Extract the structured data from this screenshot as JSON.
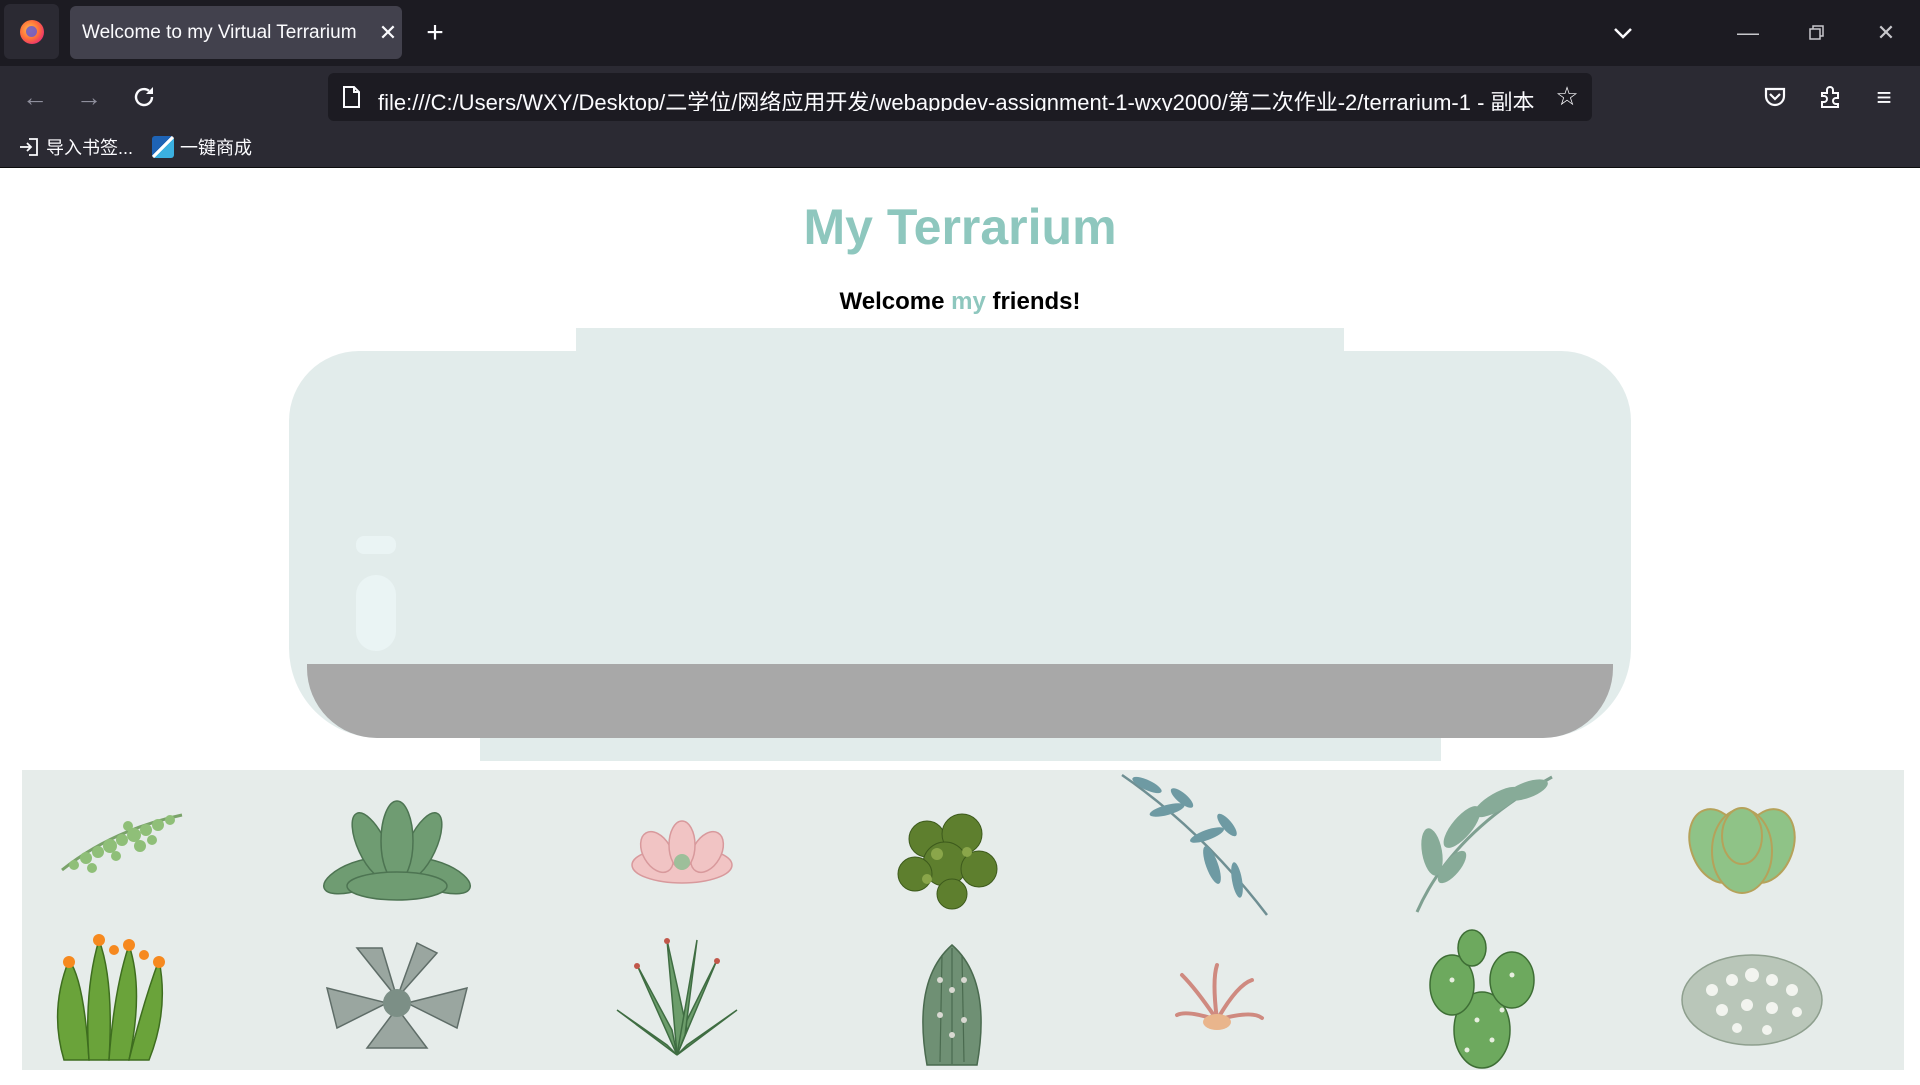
{
  "browser": {
    "tab_title": "Welcome to my Virtual Terrarium",
    "url": "file:///C:/Users/WXY/Desktop/二学位/网络应用开发/webappdev-assignment-1-wxy2000/第二次作业-2/terrarium-1 - 副本",
    "bookmarks": [
      {
        "label": "导入书签..."
      },
      {
        "label": "一键商成"
      }
    ],
    "icons": {
      "tab_close": "close-icon",
      "new_tab": "plus-icon",
      "list_tabs": "chevron-down-icon",
      "back": "arrow-left-icon",
      "forward": "arrow-right-icon",
      "reload": "reload-icon",
      "page": "page-icon",
      "bookmark_star": "star-icon",
      "pocket": "pocket-icon",
      "extensions": "puzzle-icon",
      "menu": "hamburger-icon"
    }
  },
  "page": {
    "title": "My Terrarium",
    "welcome_before": "Welcome ",
    "welcome_accent": "my",
    "welcome_after": " friends!",
    "accent_color": "#8ec7be",
    "jar_color": "#e2eceb",
    "dirt_color": "#a8a8a8"
  },
  "plants": [
    {
      "id": "plant1",
      "kind": "trailing-succulent"
    },
    {
      "id": "plant2",
      "kind": "green-rosette"
    },
    {
      "id": "plant3",
      "kind": "pink-rosette"
    },
    {
      "id": "plant4",
      "kind": "dark-green-cluster"
    },
    {
      "id": "plant5",
      "kind": "eucalyptus-branch"
    },
    {
      "id": "plant6",
      "kind": "green-leafy-branch"
    },
    {
      "id": "plant7",
      "kind": "light-green-succulent"
    },
    {
      "id": "plant8",
      "kind": "flowering-cactus"
    },
    {
      "id": "plant9",
      "kind": "grey-rosette"
    },
    {
      "id": "plant10",
      "kind": "aloe"
    },
    {
      "id": "plant11",
      "kind": "columnar-cactus"
    },
    {
      "id": "plant12",
      "kind": "air-plant"
    },
    {
      "id": "plant13",
      "kind": "prickly-pear"
    },
    {
      "id": "plant14",
      "kind": "snowball-cactus"
    }
  ]
}
